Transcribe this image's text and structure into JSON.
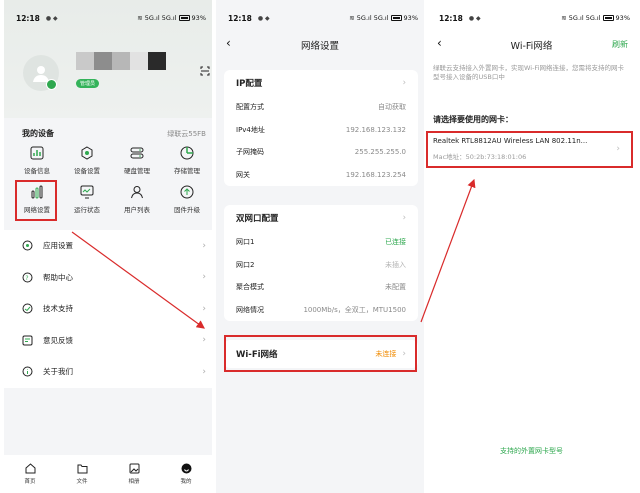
{
  "status_bar": {
    "time": "12:18",
    "battery": "93%",
    "signal": "≋ 5G.ıl 5G.ıl"
  },
  "screen_home": {
    "role_badge": "管理员",
    "section_title": "我的设备",
    "device_name": "绿联云55FB",
    "grid": [
      {
        "label": "设备信息",
        "icon": "bar-chart-icon"
      },
      {
        "label": "设备设置",
        "icon": "gear-hex-icon"
      },
      {
        "label": "硬盘管理",
        "icon": "disk-icon"
      },
      {
        "label": "存储管理",
        "icon": "pie-icon"
      },
      {
        "label": "网络设置",
        "icon": "network-bars-icon"
      },
      {
        "label": "运行状态",
        "icon": "monitor-icon"
      },
      {
        "label": "用户列表",
        "icon": "user-icon"
      },
      {
        "label": "固件升级",
        "icon": "upgrade-icon"
      }
    ],
    "menu": [
      {
        "label": "应用设置",
        "icon": "app-settings-icon"
      },
      {
        "label": "帮助中心",
        "icon": "help-icon"
      },
      {
        "label": "技术支持",
        "icon": "support-icon"
      },
      {
        "label": "意见反馈",
        "icon": "feedback-icon"
      },
      {
        "label": "关于我们",
        "icon": "info-icon"
      }
    ],
    "tabs": [
      {
        "label": "首页"
      },
      {
        "label": "文件"
      },
      {
        "label": "相册"
      },
      {
        "label": "我的"
      }
    ]
  },
  "screen_network": {
    "title": "网络设置",
    "ip_section": {
      "title": "IP配置",
      "rows": [
        {
          "key": "配置方式",
          "value": "自动获取"
        },
        {
          "key": "IPv4地址",
          "value": "192.168.123.132"
        },
        {
          "key": "子网掩码",
          "value": "255.255.255.0"
        },
        {
          "key": "网关",
          "value": "192.168.123.254"
        }
      ]
    },
    "dual_section": {
      "title": "双网口配置",
      "rows": [
        {
          "key": "网口1",
          "value": "已连接"
        },
        {
          "key": "网口2",
          "value": "未插入"
        },
        {
          "key": "聚合模式",
          "value": "未配置"
        },
        {
          "key": "网络情况",
          "value": "1000Mb/s，全双工，MTU1500"
        }
      ]
    },
    "wifi": {
      "label": "Wi-Fi网络",
      "status": "未连接"
    }
  },
  "screen_wifi": {
    "title": "Wi-Fi网络",
    "refresh": "刷新",
    "intro": "绿联云支持接入外置网卡，实现Wi-Fi网络连接，您需将支持的网卡型号接入设备的USB口中",
    "choose_title": "请选择要使用的网卡：",
    "adapter": {
      "name": "Realtek RTL8812AU Wireless LAN 802.11n...",
      "mac": "Mac地址：50:2b:73:18:01:06"
    },
    "supported_link": "支持的外置网卡型号"
  },
  "colors": {
    "accent_green": "#2fa84f",
    "warning_orange": "#f08a00",
    "highlight_red": "#d92b2b"
  }
}
